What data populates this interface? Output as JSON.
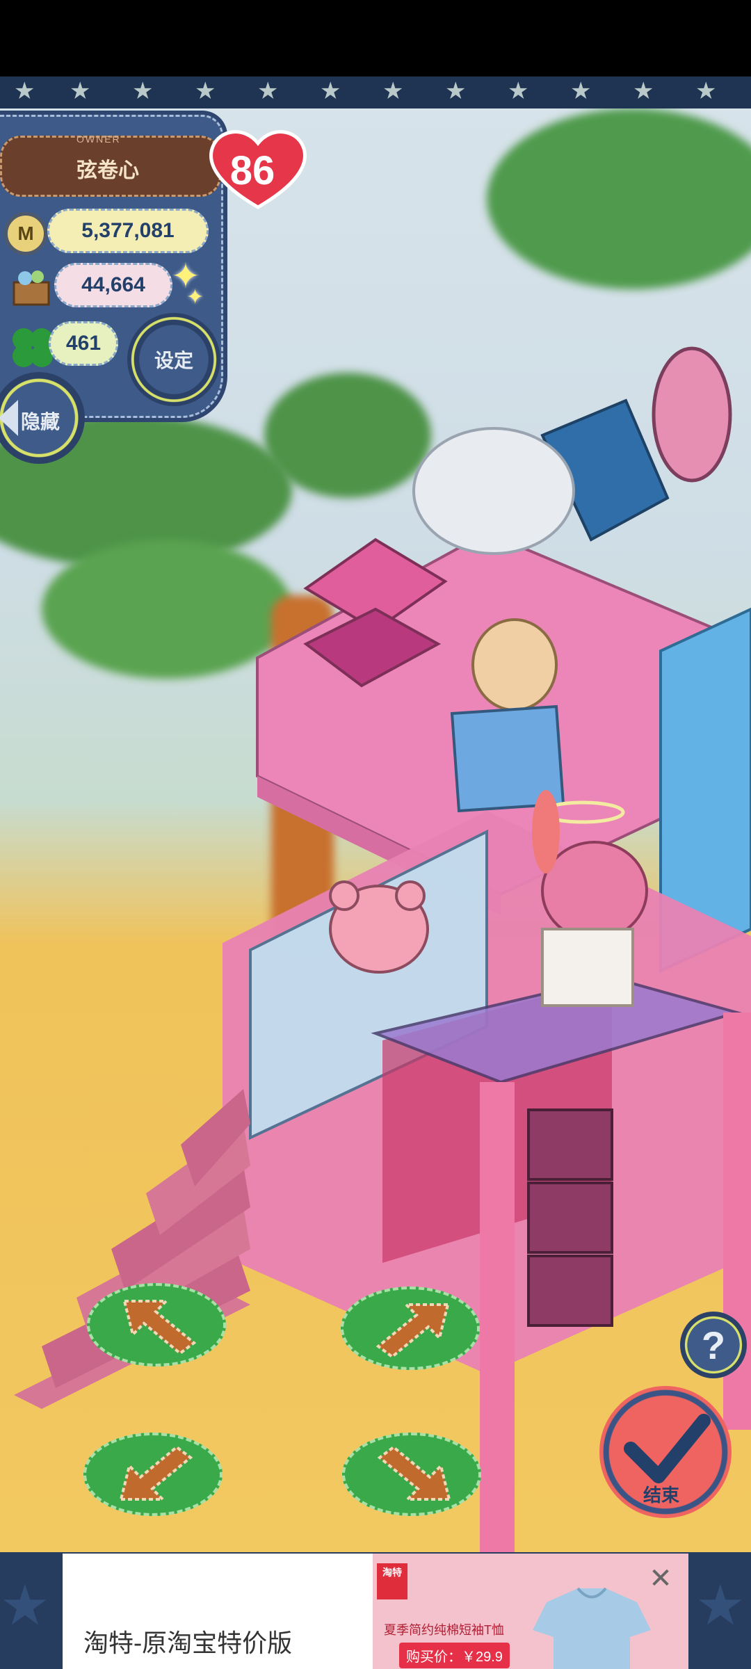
{
  "game": {
    "owner_caption": "OWNER",
    "owner_name": "弦卷心",
    "level": "86",
    "coins": "5,377,081",
    "items": "44,664",
    "clovers": "461",
    "settings_label": "设定",
    "hide_label": "隐藏",
    "help_label": "?",
    "end_label": "结束"
  },
  "icons": {
    "coin": "M",
    "crate": "crate-icon",
    "clover": "clover-icon",
    "arrow_up_left": "arrow-up-left-icon",
    "arrow_up_right": "arrow-up-right-icon",
    "arrow_down_left": "arrow-down-left-icon",
    "arrow_down_right": "arrow-down-right-icon"
  },
  "ad": {
    "title": "淘特-原淘宝特价版",
    "logo_text": "淘特",
    "product": "夏季简约纯棉短袖T恤",
    "price": "购买价：￥29.9",
    "close": "✕"
  },
  "colors": {
    "panel": "#3d5a88",
    "heart": "#e5364a",
    "arrow_pad": "#3aa94a",
    "end_button": "#ef6460",
    "ad_accent": "#e63048"
  }
}
